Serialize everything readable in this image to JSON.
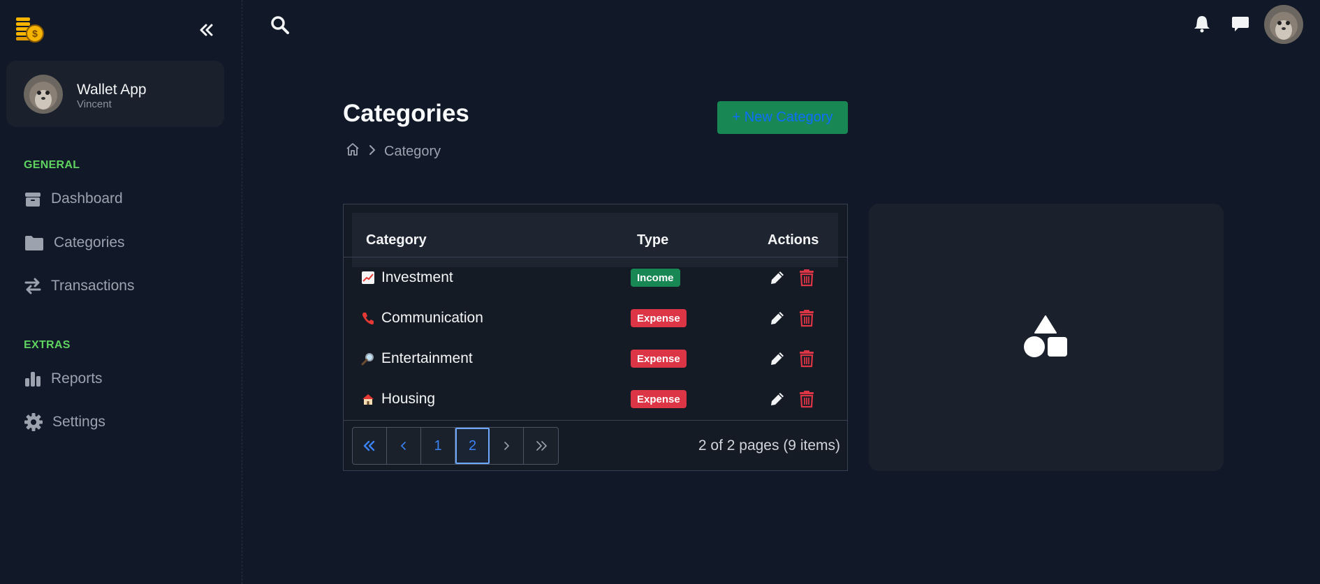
{
  "sidebar": {
    "profile": {
      "name": "Wallet App",
      "subtitle": "Vincent"
    },
    "sections": [
      {
        "title": "GENERAL",
        "items": [
          {
            "label": "Dashboard",
            "icon": "box-icon"
          },
          {
            "label": "Categories",
            "icon": "folder-icon"
          },
          {
            "label": "Transactions",
            "icon": "arrows-exchange-icon"
          }
        ]
      },
      {
        "title": "EXTRAS",
        "items": [
          {
            "label": "Reports",
            "icon": "bar-chart-icon"
          },
          {
            "label": "Settings",
            "icon": "gear-icon"
          }
        ]
      }
    ]
  },
  "header": {
    "title": "Categories",
    "breadcrumb": "Category",
    "new_button": "+ New Category"
  },
  "table": {
    "columns": [
      "Category",
      "Type",
      "Actions"
    ],
    "rows": [
      {
        "emoji": "📈",
        "name": "Investment",
        "type": "Income"
      },
      {
        "emoji": "📞",
        "name": "Communication",
        "type": "Expense"
      },
      {
        "emoji": "🔎",
        "name": "Entertainment",
        "type": "Expense"
      },
      {
        "emoji": "🏠",
        "name": "Housing",
        "type": "Expense"
      }
    ],
    "pagination": {
      "pages": [
        "1",
        "2"
      ],
      "current": "2",
      "info": "2 of 2 pages (9 items)"
    }
  },
  "colors": {
    "accent_green": "#5fd35f",
    "income": "#198754",
    "expense": "#dc3545",
    "link_blue": "#3b82f6"
  }
}
